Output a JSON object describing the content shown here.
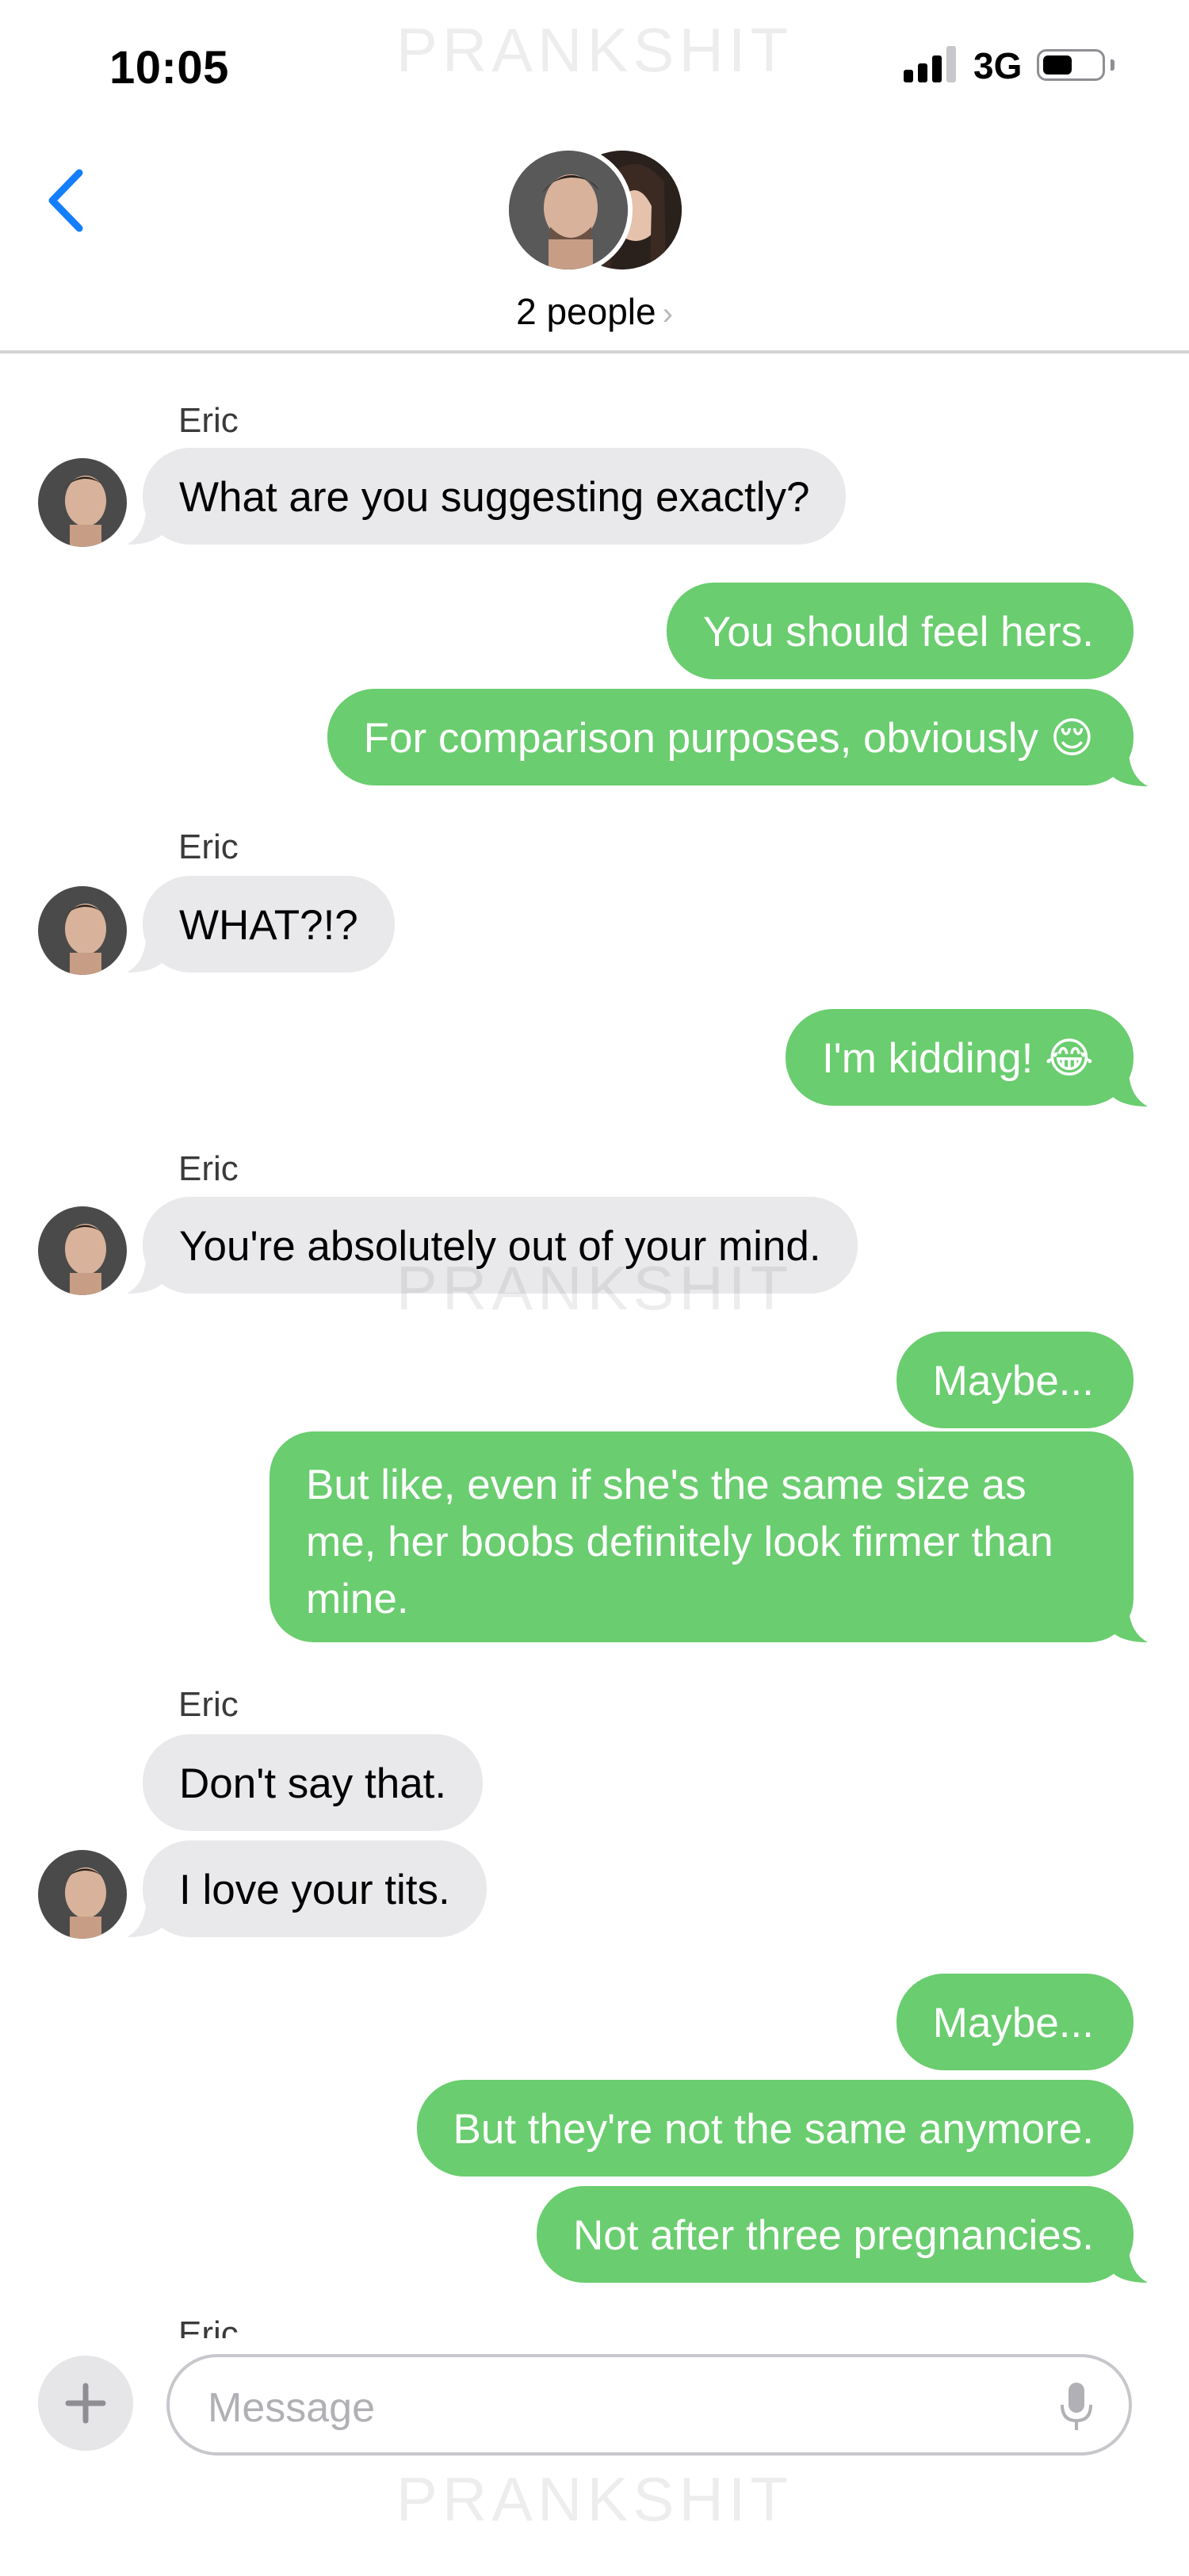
{
  "watermark": "PRANKSHIT",
  "status_bar": {
    "time": "10:05",
    "network": "3G",
    "icons": [
      "signal-icon",
      "battery-icon"
    ]
  },
  "header": {
    "back_icon": "chevron-left-icon",
    "title": "2 people",
    "chevron": "›"
  },
  "messages": [
    {
      "sender": "Eric",
      "direction": "in",
      "text": "What are you suggesting exactly?"
    },
    {
      "direction": "out",
      "text": "You should feel hers."
    },
    {
      "direction": "out",
      "text": "For comparison purposes, obviously 😌"
    },
    {
      "sender": "Eric",
      "direction": "in",
      "text": "WHAT?!?"
    },
    {
      "direction": "out",
      "text": "I'm kidding! 😂"
    },
    {
      "sender": "Eric",
      "direction": "in",
      "text": "You're absolutely out of your mind."
    },
    {
      "direction": "out",
      "text": "Maybe..."
    },
    {
      "direction": "out",
      "text": "But like, even if she's the same size as me, her boobs definitely look firmer than mine."
    },
    {
      "sender": "Eric",
      "direction": "in",
      "text": "Don't say that."
    },
    {
      "direction": "in",
      "text": "I love your tits."
    },
    {
      "direction": "out",
      "text": "Maybe..."
    },
    {
      "direction": "out",
      "text": "But they're not the same anymore."
    },
    {
      "direction": "out",
      "text": "Not after three pregnancies."
    }
  ],
  "cut_off_sender": "Eric",
  "composer": {
    "placeholder": "Message",
    "plus_icon": "plus-icon",
    "mic_icon": "microphone-icon"
  },
  "colors": {
    "outgoing_bubble": "#6acd6f",
    "incoming_bubble": "#e9e9eb",
    "accent": "#147efb"
  }
}
